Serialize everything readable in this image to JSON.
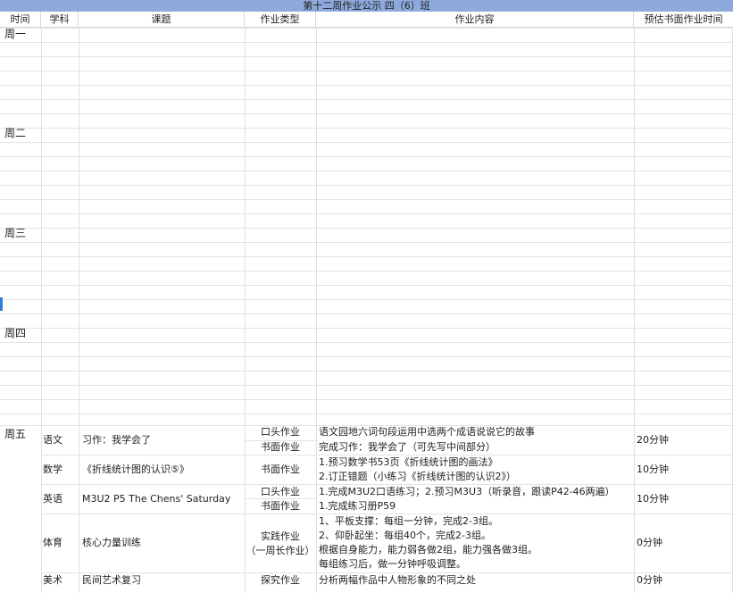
{
  "sheet": {
    "title": "第十二周作业公示  四（6）班",
    "headers": {
      "time": "时间",
      "subject": "学科",
      "topic": "课题",
      "type": "作业类型",
      "content": "作业内容",
      "duration": "预估书面作业时间"
    },
    "days": [
      "周一",
      "周二",
      "周三",
      "周四",
      "周五"
    ],
    "friday": {
      "chinese": {
        "subject": "语文",
        "topic": "习作：我学会了",
        "type_1": "口头作业",
        "type_2": "书面作业",
        "content_1": "语文园地六词句段运用中选两个成语说说它的故事",
        "content_2": "完成习作：我学会了（可先写中间部分）",
        "duration": "20分钟"
      },
      "math": {
        "subject": "数学",
        "topic": "《折线统计图的认识⑤》",
        "type": "书面作业",
        "content_1": "1.预习数学书53页《折线统计图的画法》",
        "content_2": "2.订正错题（小练习《折线统计图的认识2》）",
        "duration": "10分钟"
      },
      "english": {
        "subject": "英语",
        "topic": "M3U2 P5 The Chens' Saturday",
        "type_1": "口头作业",
        "type_2": "书面作业",
        "content_1": "1.完成M3U2口语练习；2.预习M3U3（听录音，跟读P42-46两遍）",
        "content_2": "1.完成练习册P59",
        "duration": "10分钟"
      },
      "pe": {
        "subject": "体育",
        "topic": "核心力量训练",
        "type_1": "实践作业",
        "type_2": "（一周长作业）",
        "content_1": "1、平板支撑：每组一分钟，完成2-3组。",
        "content_2": "2、仰卧起坐：每组40个，完成2-3组。",
        "content_3": "根据自身能力，能力弱各做2组，能力强各做3组。",
        "content_4": "每组练习后，做一分钟呼吸调整。",
        "duration": "0分钟"
      },
      "art": {
        "subject": "美术",
        "topic": "民间艺术复习",
        "type": "探究作业",
        "content": "分析两幅作品中人物形象的不同之处",
        "duration": "0分钟"
      }
    }
  },
  "colors": {
    "title_bg": "#8ea9db",
    "grid": "#e3e3e3",
    "cursor": "#2f7fd6"
  }
}
